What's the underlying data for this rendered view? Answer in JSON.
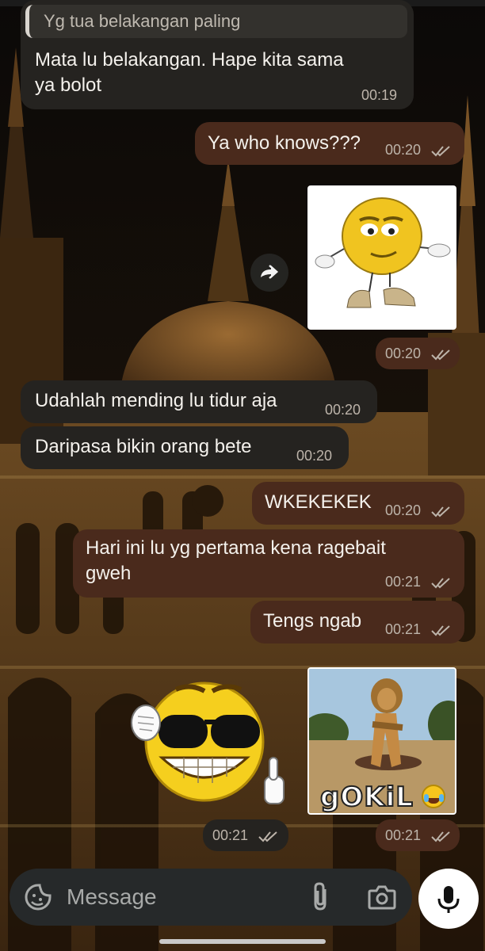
{
  "messages": [
    {
      "id": "m1",
      "direction": "in",
      "reply_to": "Yg tua belakangan paling",
      "lines": [
        "Mata lu belakangan. Hape kita sama",
        "ya bolot"
      ],
      "time": "00:19"
    },
    {
      "id": "m2",
      "direction": "out",
      "text": "Ya who knows???",
      "time": "00:20",
      "status": "read"
    },
    {
      "id": "m3",
      "direction": "out",
      "type": "sticker",
      "sticker": "walking-smiley-sticker",
      "time": "00:20",
      "status": "read"
    },
    {
      "id": "m4",
      "direction": "in",
      "text": "Udahlah mending lu tidur aja",
      "time": "00:20"
    },
    {
      "id": "m5",
      "direction": "in",
      "text": "Daripasa bikin orang bete",
      "time": "00:20"
    },
    {
      "id": "m6",
      "direction": "out",
      "text": "WKEKEKEK",
      "time": "00:20",
      "status": "read"
    },
    {
      "id": "m7",
      "direction": "out",
      "lines": [
        "Hari ini lu yg pertama kena ragebait",
        "gweh"
      ],
      "time": "00:21",
      "status": "read"
    },
    {
      "id": "m8",
      "direction": "out",
      "text": "Tengs ngab",
      "time": "00:21",
      "status": "read"
    },
    {
      "id": "m9",
      "direction": "in",
      "type": "sticker",
      "sticker": "sunglasses-smiley-sticker",
      "time": "00:21",
      "status": "read"
    },
    {
      "id": "m10",
      "direction": "out",
      "type": "sticker",
      "sticker": "lion-gokil-sticker",
      "sticker_caption": "gOKiL",
      "time": "00:21",
      "status": "read"
    }
  ],
  "composer": {
    "placeholder": "Message",
    "icons": [
      "emoji-sticker-icon",
      "attach-paperclip-icon",
      "camera-icon",
      "microphone-icon"
    ]
  },
  "colors": {
    "incoming_bubble": "#252320",
    "outgoing_bubble": "#4a2a1c",
    "text": "#f4f1ec",
    "timestamp": "#bdb4aa"
  }
}
